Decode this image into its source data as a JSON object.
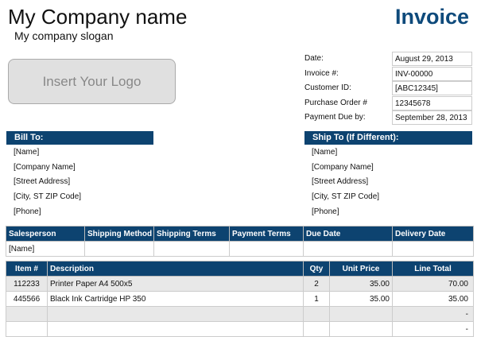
{
  "header": {
    "company": "My Company name",
    "slogan": "My company slogan",
    "title": "Invoice",
    "logo": "Insert Your Logo"
  },
  "info": [
    {
      "label": "Date:",
      "value": "August 29, 2013"
    },
    {
      "label": "Invoice #:",
      "value": "INV-00000"
    },
    {
      "label": "Customer ID:",
      "value": "[ABC12345]"
    },
    {
      "label": "Purchase Order #",
      "value": "12345678"
    },
    {
      "label": "Payment Due by:",
      "value": "September 28, 2013"
    }
  ],
  "bill_to": {
    "title": "Bill To:",
    "lines": [
      "[Name]",
      "[Company Name]",
      "[Street Address]",
      "[City, ST  ZIP Code]",
      "[Phone]"
    ]
  },
  "ship_to": {
    "title": "Ship To (If Different):",
    "lines": [
      "[Name]",
      "[Company Name]",
      "[Street Address]",
      "[City, ST  ZIP Code]",
      "[Phone]"
    ]
  },
  "shipping": {
    "headers": [
      "Salesperson",
      "Shipping Method",
      "Shipping Terms",
      "Payment Terms",
      "Due Date",
      "Delivery Date"
    ],
    "values": [
      "[Name]",
      "",
      "",
      "",
      "",
      ""
    ]
  },
  "items": {
    "headers": [
      "Item #",
      "Description",
      "Qty",
      "Unit Price",
      "Line Total"
    ],
    "rows": [
      [
        "112233",
        "Printer Paper A4 500x5",
        "2",
        "35.00",
        "70.00"
      ],
      [
        "445566",
        "Black Ink Cartridge HP 350",
        "1",
        "35.00",
        "35.00"
      ],
      [
        "",
        "",
        "",
        "",
        "-"
      ],
      [
        "",
        "",
        "",
        "",
        "-"
      ]
    ]
  }
}
